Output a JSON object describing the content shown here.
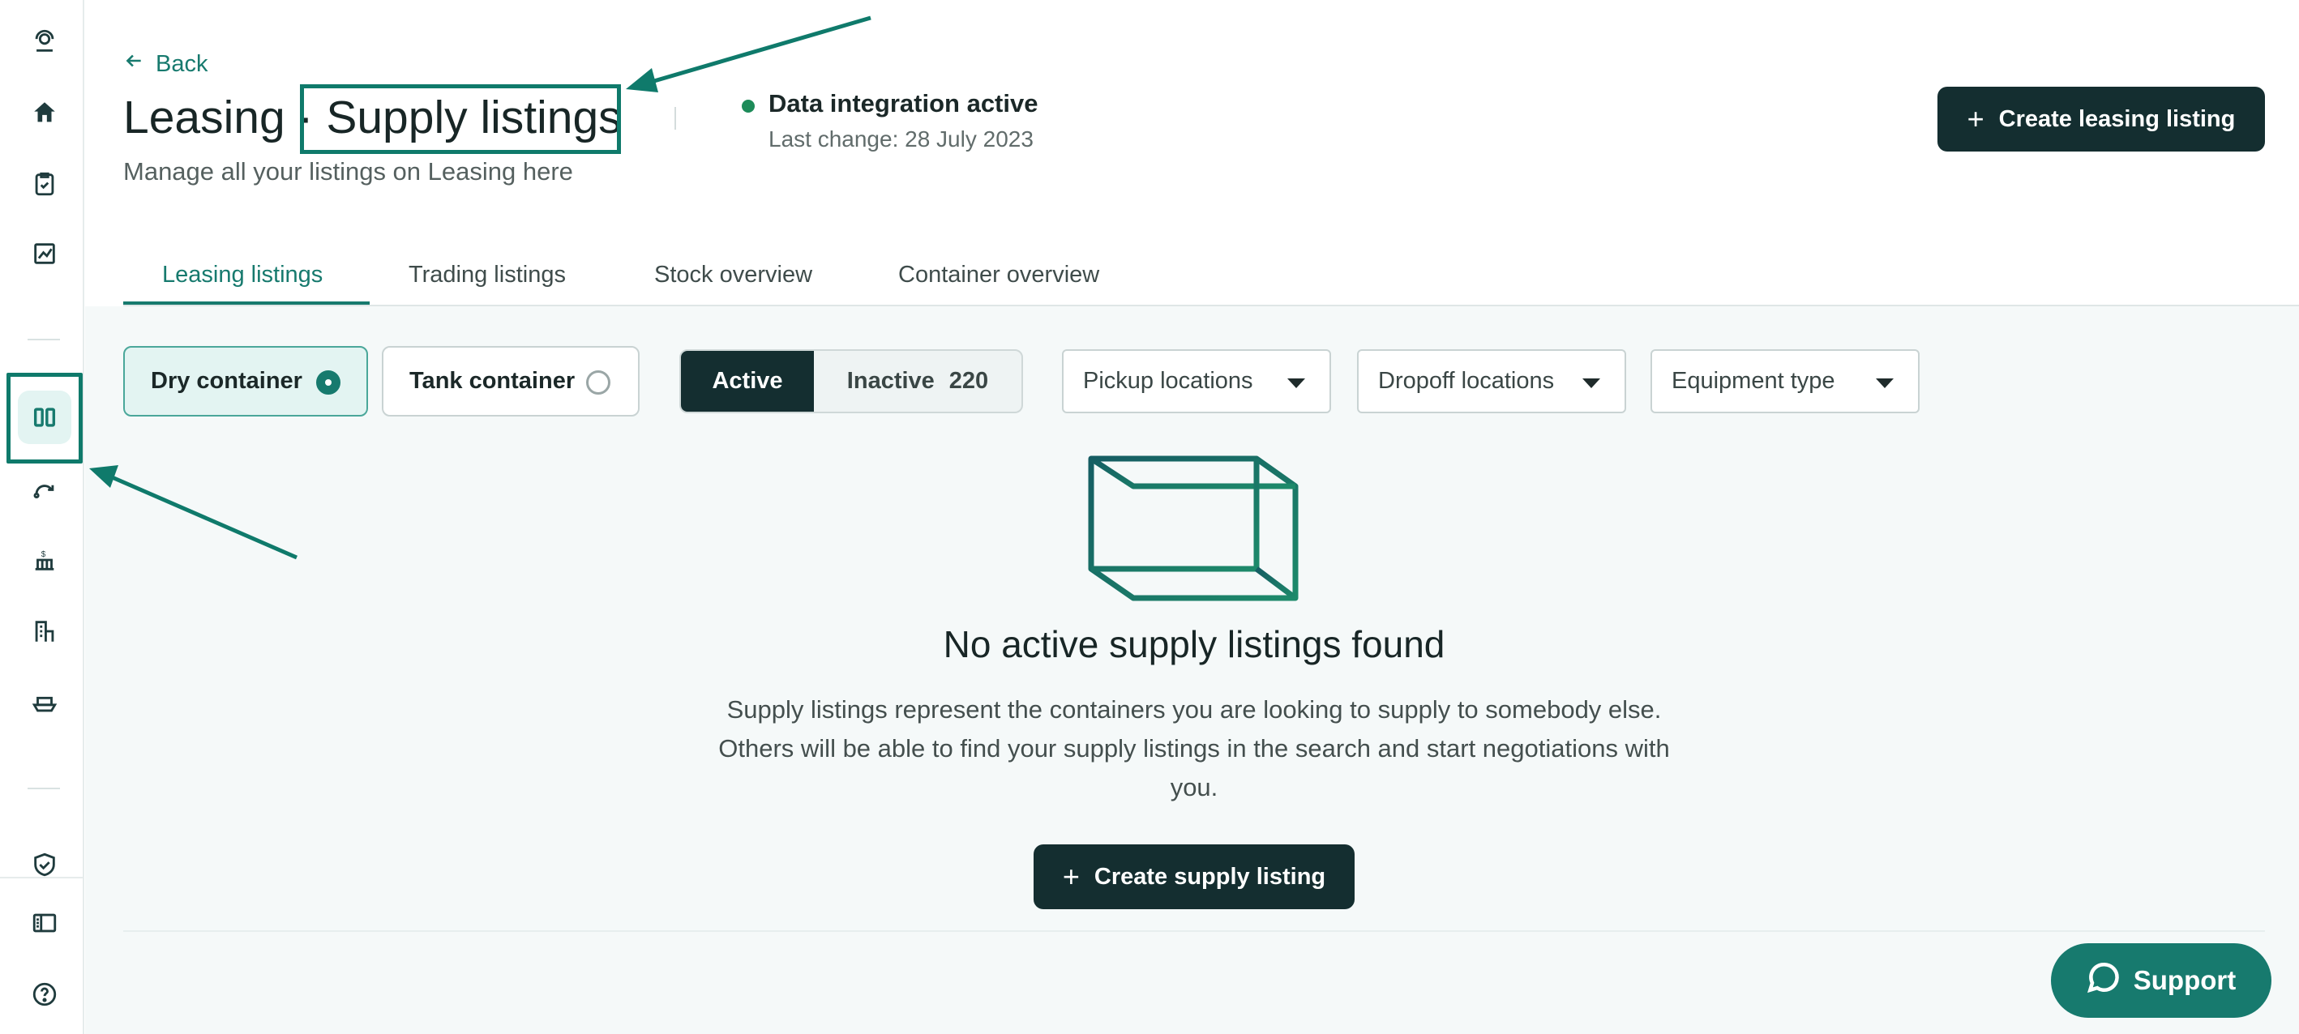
{
  "sidebar": {
    "items": [
      {
        "icon": "user-headset-icon"
      },
      {
        "icon": "home-icon"
      },
      {
        "icon": "clipboard-check-icon"
      },
      {
        "icon": "chart-icon"
      },
      {
        "icon": "columns-icon",
        "active": true
      },
      {
        "icon": "route-icon"
      },
      {
        "icon": "pricing-icon"
      },
      {
        "icon": "depot-icon"
      },
      {
        "icon": "ship-icon"
      },
      {
        "icon": "shield-check-icon"
      },
      {
        "icon": "sidebar-toggle-icon"
      },
      {
        "icon": "help-icon"
      }
    ]
  },
  "header": {
    "back_label": "Back",
    "title_prefix": "Leasing · ",
    "title_main": "Supply listings",
    "subtitle": "Manage all your listings on Leasing here",
    "status_label": "Data integration active",
    "status_sub": "Last change: 28 July 2023",
    "create_button": "Create leasing listing"
  },
  "tabs": [
    {
      "label": "Leasing listings",
      "active": true
    },
    {
      "label": "Trading listings"
    },
    {
      "label": "Stock overview"
    },
    {
      "label": "Container overview"
    }
  ],
  "filters": {
    "container_types": [
      {
        "label": "Dry container",
        "selected": true
      },
      {
        "label": "Tank container",
        "selected": false
      }
    ],
    "status_toggle": {
      "active_label": "Active",
      "inactive_label": "Inactive",
      "inactive_count": "220"
    },
    "dropdowns": [
      {
        "label": "Pickup locations"
      },
      {
        "label": "Dropoff locations"
      },
      {
        "label": "Equipment type"
      }
    ]
  },
  "empty_state": {
    "title": "No active supply listings found",
    "description": "Supply listings represent the containers you are looking to supply to somebody else. Others will be able to find your supply listings in the search and start negotiations with you.",
    "button": "Create supply listing"
  },
  "support": {
    "label": "Support"
  },
  "colors": {
    "accent": "#177a6e",
    "dark": "#142e30",
    "status_green": "#1d8b59",
    "annotation": "#0f7a6b"
  }
}
